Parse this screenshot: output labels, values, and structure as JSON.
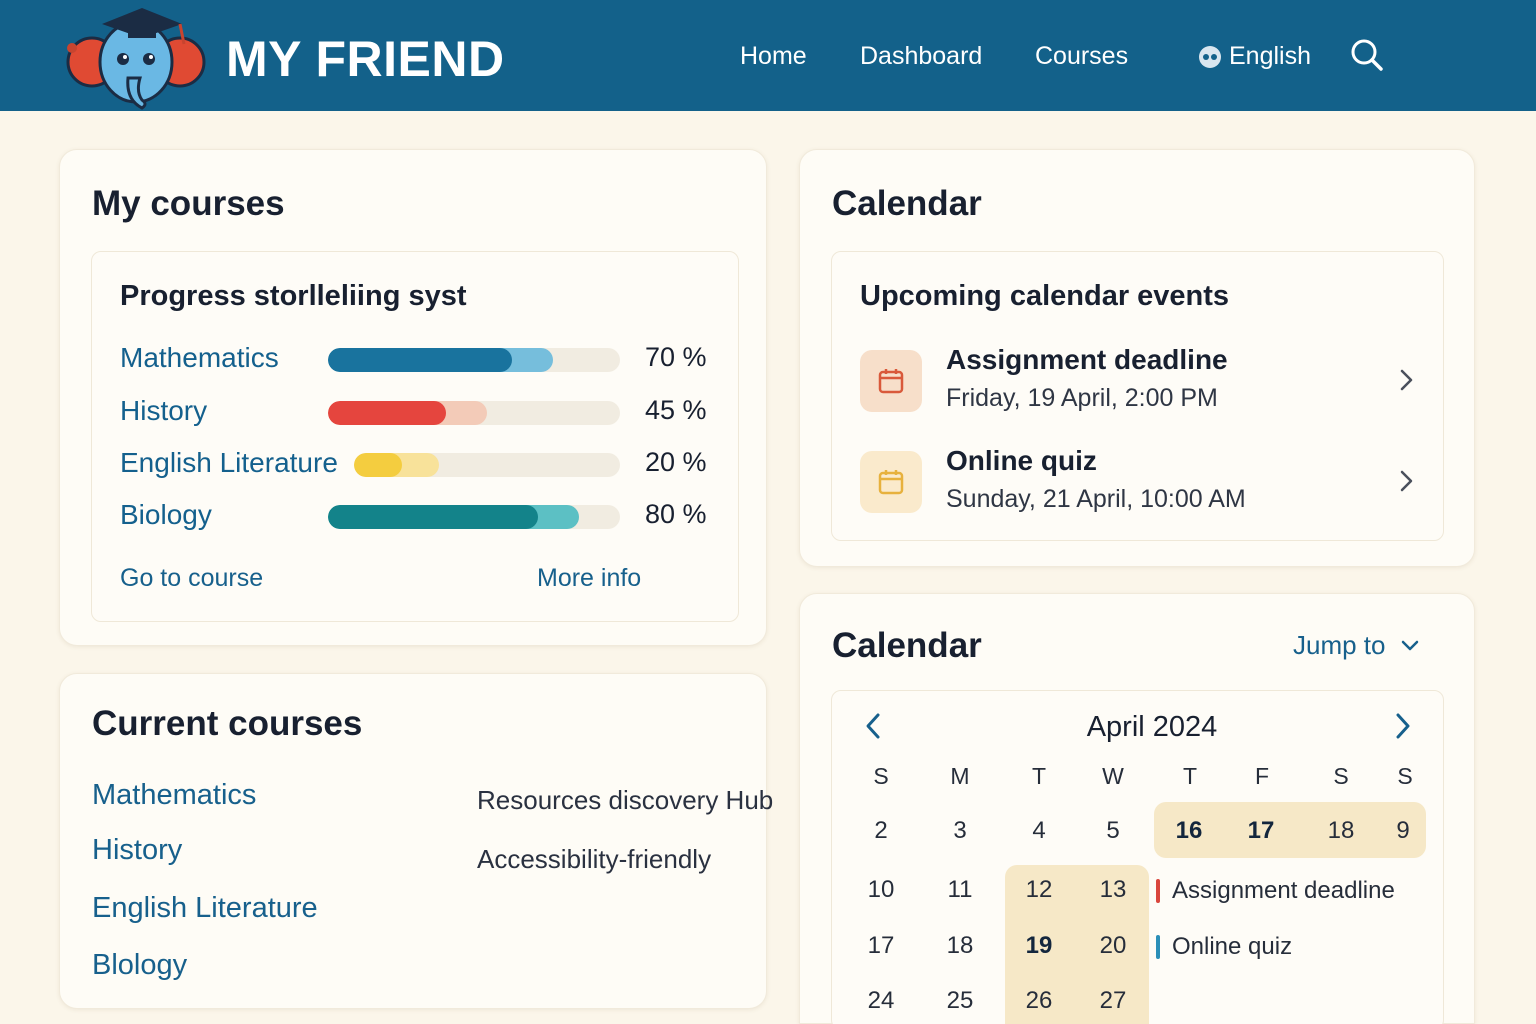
{
  "header": {
    "brand": "MY FRIEND",
    "nav": [
      "Home",
      "Dashboard",
      "Courses"
    ],
    "language": "English",
    "accent": "#13618a"
  },
  "my_courses": {
    "title": "My courses",
    "panel_title": "Progress storlleliing syst",
    "courses": [
      {
        "name": "Mathematics",
        "progress_label": "70 %",
        "progress": 0.7,
        "color": "#19739e",
        "light": "#76bedc"
      },
      {
        "name": "History",
        "progress_label": "45 %",
        "progress": 0.45,
        "color": "#e5453e",
        "light": "#f3cbb8"
      },
      {
        "name": "English Literature",
        "progress_label": "20 %",
        "progress": 0.2,
        "color": "#f4cd3f",
        "light": "#f8e29a"
      },
      {
        "name": "Biology",
        "progress_label": "80 %",
        "progress": 0.8,
        "color": "#13838a",
        "light": "#5cc0c4"
      }
    ],
    "go_to_course": "Go to course",
    "more_info": "More info"
  },
  "current_courses": {
    "title": "Current courses",
    "courses": [
      "Mathematics",
      "History",
      "English Literature",
      "Blology"
    ],
    "notes": [
      "Resources discovery Hub",
      "Accessibility-friendly"
    ]
  },
  "calendar_events": {
    "title": "Calendar",
    "panel_title": "Upcoming calendar events",
    "events": [
      {
        "title": "Assignment deadline",
        "date": "Friday, 19 April, 2:00 PM",
        "icon": "calendar-icon",
        "color": "#d9593a"
      },
      {
        "title": "Online quiz",
        "date": "Sunday, 21 April, 10:00 AM",
        "icon": "calendar-icon",
        "color": "#e7b13d"
      }
    ]
  },
  "calendar": {
    "title": "Calendar",
    "jump_to": "Jump to",
    "month": "April 2024",
    "weekdays": [
      "S",
      "M",
      "T",
      "W",
      "T",
      "F",
      "S",
      "S"
    ],
    "rows": [
      [
        "2",
        "3",
        "4",
        "5",
        "16",
        "17",
        "18",
        "9"
      ],
      [
        "10",
        "11",
        "12",
        "13"
      ],
      [
        "17",
        "18",
        "19",
        "20"
      ],
      [
        "24",
        "25",
        "26",
        "27"
      ]
    ],
    "legend": [
      {
        "label": "Assignment deadline",
        "color": "#d9463d"
      },
      {
        "label": "Online quiz",
        "color": "#2b8fb8"
      }
    ]
  }
}
